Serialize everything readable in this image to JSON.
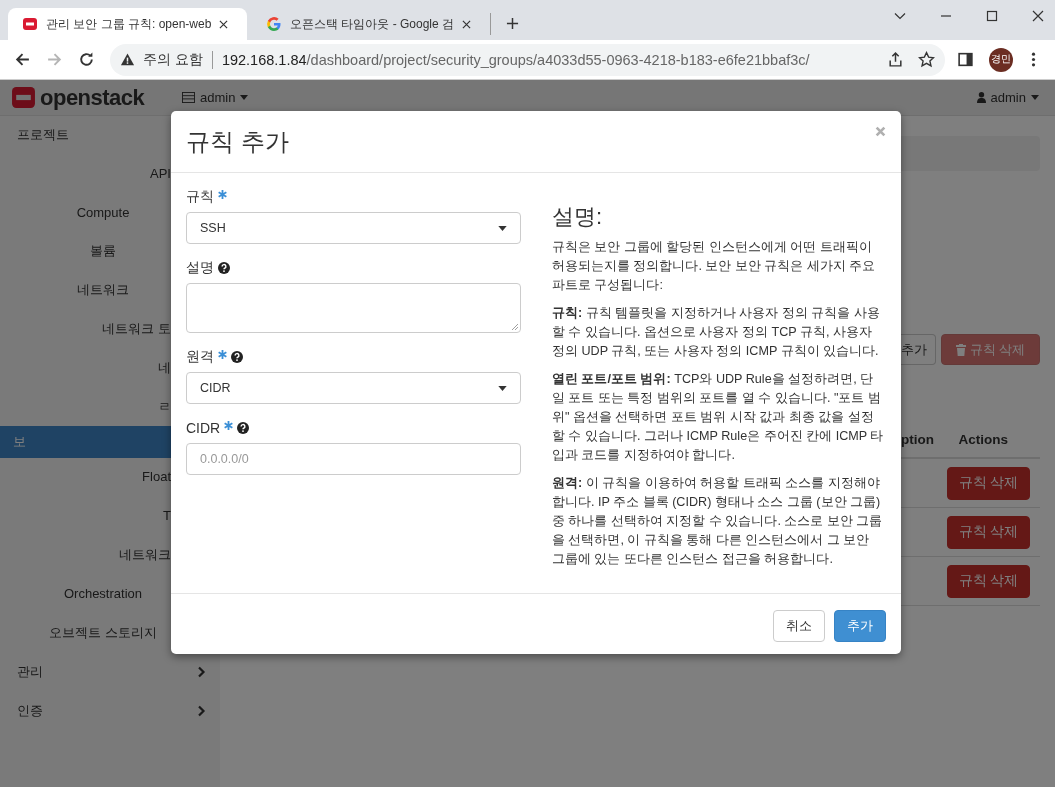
{
  "browser": {
    "tabs": [
      {
        "title": "관리 보안 그룹 규칙: open-web",
        "selected": true,
        "kind": "openstack"
      },
      {
        "title": "오픈스택 타임아웃 - Google 검",
        "selected": false,
        "kind": "google"
      }
    ],
    "nav": {
      "forward_disabled": true
    },
    "address": {
      "security": "주의 요함",
      "host": "192.168.1.84",
      "path": "/dashboard/project/security_groups/a4033d55-0963-4218-b183-e6fe21bbaf3c/"
    },
    "profile": "경민"
  },
  "topbar": {
    "logo": "openstack",
    "project": "admin",
    "user": "admin"
  },
  "sidebar": [
    {
      "label": "프로젝트",
      "expanded": true,
      "children": [
        {
          "label": "API",
          "kind": "cut",
          "selected": false
        },
        {
          "label": "Compute",
          "kind": "panel",
          "selected": false
        },
        {
          "label": "볼륨",
          "kind": "panel",
          "selected": false
        },
        {
          "label": "네트워크",
          "kind": "panel",
          "selected": false,
          "children": [
            {
              "label": "네트워크 토",
              "kind": "cut",
              "selected": false
            },
            {
              "label": "네",
              "kind": "cut",
              "selected": false
            },
            {
              "label": "ㄹ",
              "kind": "cut",
              "selected": false
            },
            {
              "label": "보",
              "kind": "cut",
              "selected": true
            },
            {
              "label": "Float",
              "kind": "cut",
              "selected": false
            },
            {
              "label": "T",
              "kind": "cut",
              "selected": false
            },
            {
              "label": "네트워크",
              "kind": "cut",
              "selected": false
            }
          ]
        },
        {
          "label": "Orchestration",
          "kind": "panel",
          "selected": false
        },
        {
          "label": "오브젝트 스토리지",
          "kind": "panel",
          "selected": false
        }
      ]
    },
    {
      "label": "관리",
      "expanded": false
    },
    {
      "label": "인증",
      "expanded": false
    }
  ],
  "page": {
    "toolbar": [
      {
        "label": "추가",
        "kind": "outline",
        "disabled": false
      },
      {
        "label": "규칙 삭제",
        "kind": "danger",
        "disabled": true
      }
    ],
    "table": {
      "columns": [
        "ption",
        "Actions"
      ],
      "rows": [
        {
          "action": "규칙 삭제"
        },
        {
          "action": "규칙 삭제"
        },
        {
          "action": "규칙 삭제"
        }
      ]
    }
  },
  "modal": {
    "title": "규칙 추가",
    "fields": [
      {
        "label": "규칙",
        "required": true,
        "help": false,
        "kind": "select",
        "value": "SSH"
      },
      {
        "label": "설명",
        "required": false,
        "help": true,
        "kind": "textarea"
      },
      {
        "label": "원격",
        "required": true,
        "help": true,
        "kind": "select",
        "value": "CIDR"
      },
      {
        "label": "CIDR",
        "required": true,
        "help": true,
        "kind": "input",
        "placeholder": "0.0.0.0/0"
      }
    ],
    "description": {
      "title": "설명:",
      "paragraphs": [
        "규칙은 보안 그룹에 할당된 인스턴스에게 어떤 트래픽이 허용되는지를 정의합니다. 보안 보안 규칙은 세가지 주요 파트로 구성됩니다:",
        "**규칙:** 규칙 템플릿을 지정하거나 사용자 정의 규칙을 사용할 수 있습니다. 옵션으로 사용자 정의 TCP 규칙, 사용자 정의 UDP 규칙, 또는 사용자 정의 ICMP 규칙이 있습니다.",
        "**열린 포트/포트 범위:** TCP와 UDP Rule을 설정하려면, 단일 포트 또는 특정 범위의 포트를 열 수 있습니다. \"포트 범위\" 옵션을 선택하면 포트 범위 시작 값과 최종 값을 설정할 수 있습니다. 그러나 ICMP Rule은 주어진 칸에 ICMP 타입과 코드를 지정하여야 합니다.",
        "**원격:** 이 규칙을 이용하여 허용할 트래픽 소스를 지정해야 합니다. IP 주소 블록 (CIDR) 형태나 소스 그룹 (보안 그룹) 중 하나를 선택하여 지정할 수 있습니다. 소스로 보안 그룹을 선택하면, 이 규칙을 통해 다른 인스턴스에서 그 보안 그룹에 있는 또다른 인스턴스 접근을 허용합니다."
      ]
    },
    "buttons": [
      {
        "label": "취소",
        "kind": "default"
      },
      {
        "label": "추가",
        "kind": "primary"
      }
    ]
  }
}
